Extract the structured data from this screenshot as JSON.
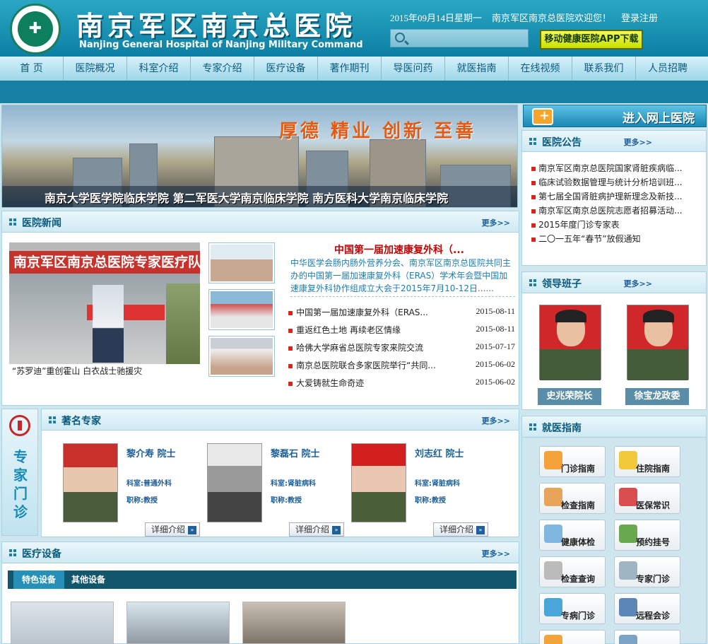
{
  "header": {
    "title": "南京军区南京总医院",
    "subtitle": "Nanjing General Hospital of Nanjing Military Command",
    "date_text": "2015年09月14日星期一",
    "welcome": "南京军区南京总医院欢迎您！",
    "login": "登录注册",
    "app_button": "移动健康医院APP下载",
    "search_value": ""
  },
  "nav": [
    "首 页",
    "医院概况",
    "科室介绍",
    "专家介绍",
    "医疗设备",
    "著作期刊",
    "导医问药",
    "就医指南",
    "在线视频",
    "联系我们",
    "人员招聘"
  ],
  "banner": {
    "motto": "厚德 精业 创新 至善",
    "schools": "南京大学医学院临床学院   第二军医大学南京临床学院   南方医科大学南京临床学院"
  },
  "news": {
    "title": "医院新闻",
    "more": "更多>>",
    "caption": "“苏罗迪”重创霍山 白衣战士驰援灾",
    "sign_text": "南京军区南京总医院专家医疗队来",
    "headline": "中国第一届加速康复外科（...",
    "summary": "中华医学会肠内肠外营养分会、南京军区南京总医院共同主办的中国第一届加速康复外科（ERAS）学术年会暨中国加速康复外科协作组成立大会于2015年7月10-12日......",
    "items": [
      {
        "text": "中国第一届加速康复外科（ERAS...",
        "date": "2015-08-11"
      },
      {
        "text": "重返红色土地  再续老区情缘",
        "date": "2015-08-11"
      },
      {
        "text": "哈佛大学麻省总医院专家来院交流",
        "date": "2015-07-17"
      },
      {
        "text": "南京总医院联合多家医院举行“共同...",
        "date": "2015-06-02"
      },
      {
        "text": "大爱铸就生命奇迹",
        "date": "2015-06-02"
      }
    ]
  },
  "experts": {
    "side_label": "专家门诊",
    "title": "著名专家",
    "more": "更多>>",
    "list": [
      {
        "name": "黎介寿  院士",
        "dept": "科室:普通外科",
        "title": "职称:教授",
        "btn": "详细介绍"
      },
      {
        "name": "黎磊石  院士",
        "dept": "科室:肾脏病科",
        "title": "职称:教授",
        "btn": "详细介绍"
      },
      {
        "name": "刘志红  院士",
        "dept": "科室:肾脏病科",
        "title": "职称:教授",
        "btn": "详细介绍"
      }
    ]
  },
  "equipment": {
    "title": "医疗设备",
    "more": "更多>>",
    "tabs": [
      "特色设备",
      "其他设备"
    ]
  },
  "right": {
    "online": "进入网上医院",
    "notice_title": "医院公告",
    "notice_more": "更多>>",
    "notices": [
      "南京军区南京总医院国家肾脏疾病临...",
      "临床试验数据管理与统计分析培训班...",
      "第七届全国肾脏病护理新理念及新技...",
      "南京军区南京总医院志愿者招募活动...",
      "2015年度门诊专家表",
      "二〇一五年“春节”放假通知"
    ],
    "leaders_title": "领导班子",
    "leaders_more": "更多>>",
    "leaders": [
      "史兆荣院长",
      "徐宝龙政委"
    ],
    "guide_title": "就医指南",
    "guides": [
      "门诊指南",
      "住院指南",
      "检查指南",
      "医保常识",
      "健康体检",
      "预约挂号",
      "检查查询",
      "专家门诊",
      "专病门诊",
      "远程会诊"
    ]
  },
  "colors": {
    "brand": "#0c7fa3",
    "accent": "#c40000",
    "nav_text": "#0d5b7e"
  }
}
